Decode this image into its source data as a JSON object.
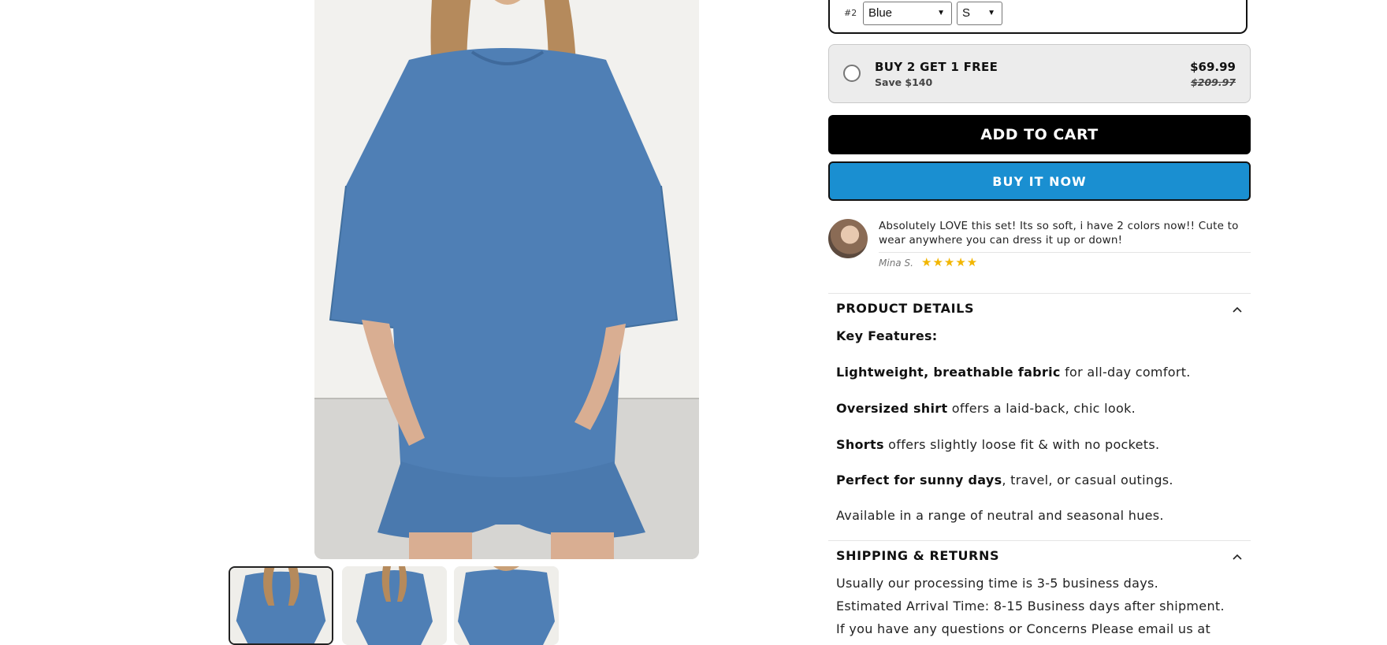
{
  "variant": {
    "number": "#2",
    "color": "Blue",
    "size": "S"
  },
  "bundle": {
    "title": "BUY 2 GET 1 FREE",
    "save": "Save $140",
    "price": "$69.99",
    "compare_price": "$209.97",
    "selected": false
  },
  "buttons": {
    "add_to_cart": "ADD TO CART",
    "buy_now": "BUY IT NOW"
  },
  "review": {
    "text": "Absolutely LOVE this set! Its so soft, i have 2 colors now!! Cute to wear anywhere you can dress it up or down!",
    "author": "Mina S.",
    "stars": "★★★★★",
    "rating": 5
  },
  "product_details": {
    "title": "PRODUCT DETAILS",
    "heading": "Key Features:",
    "features": [
      {
        "bold": "Lightweight, breathable fabric",
        "rest": " for all-day comfort."
      },
      {
        "bold": "Oversized shirt",
        "rest": " offers a laid-back, chic look."
      },
      {
        "bold": "Shorts",
        "rest": " offers slightly loose fit & with no pockets."
      },
      {
        "bold": "Perfect for sunny days",
        "rest": ", travel, or casual outings."
      }
    ],
    "note": "Available in a range of neutral and seasonal hues."
  },
  "shipping": {
    "title": "SHIPPING & RETURNS",
    "lines": [
      "Usually our processing time is 3-5 business days.",
      "Estimated Arrival Time: 8-15 Business days after shipment.",
      "If you have any questions or Concerns Please email us at"
    ]
  },
  "gallery": {
    "thumb_count": 3,
    "active_thumb": 0
  },
  "colors": {
    "garment": "#4f7fb5",
    "accent_blue": "#1a8fd1",
    "star": "#f2b600"
  }
}
